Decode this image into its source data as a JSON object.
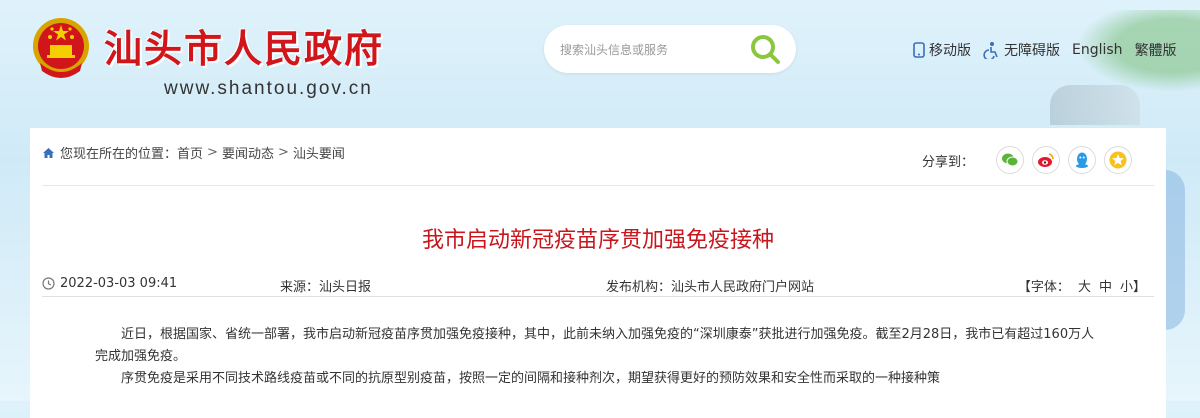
{
  "header": {
    "site_name": "汕头市人民政府",
    "site_url": "www.shantou.gov.cn",
    "search_placeholder": "搜索汕头信息或服务",
    "links": [
      "移动版",
      "无障碍版",
      "English",
      "繁體版"
    ]
  },
  "breadcrumb": {
    "prefix": "您现在所在的位置：",
    "items": [
      "首页",
      "要闻动态",
      "汕头要闻"
    ]
  },
  "share": {
    "label": "分享到："
  },
  "article": {
    "title": "我市启动新冠疫苗序贯加强免疫接种",
    "date": "2022-03-03 09:41",
    "source": "来源：汕头日报",
    "publisher": "发布机构：汕头市人民政府门户网站",
    "font_size_label": "【字体：",
    "font_sizes": [
      "大",
      "中",
      "小"
    ],
    "font_size_close": "】",
    "paragraphs": [
      "近日，根据国家、省统一部署，我市启动新冠疫苗序贯加强免疫接种，其中，此前未纳入加强免疫的“深圳康泰”获批进行加强免疫。截至2月28日，我市已有超过160万人完成加强免疫。",
      "序贯免疫是采用不同技术路线疫苗或不同的抗原型别疫苗，按照一定的间隔和接种剂次，期望获得更好的预防效果和安全性而采取的一种接种策"
    ]
  },
  "colors": {
    "brand_red": "#c8161d",
    "accent_green": "#8cc63f"
  }
}
